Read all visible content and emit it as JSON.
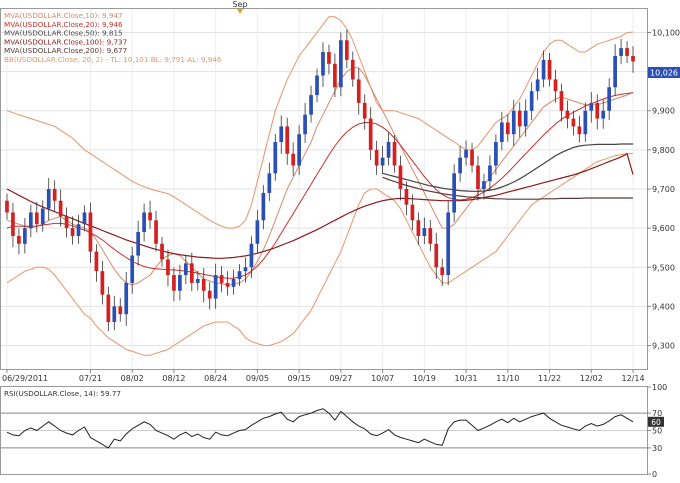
{
  "chart_data": [
    {
      "type": "candlestick",
      "panel": "price",
      "time_marker": "Sep",
      "last_price": "10,026",
      "ylim": [
        9240,
        10160
      ],
      "y_ticks": [
        9300,
        9400,
        9500,
        9600,
        9700,
        9800,
        9900,
        10000,
        10100
      ],
      "y_tick_labels": [
        "9,300",
        "9,400",
        "9,500",
        "9,600",
        "9,700",
        "9,800",
        "9,900",
        "10,000",
        "10,100"
      ],
      "x_tick_labels": [
        "06/29/2011",
        "07/21",
        "08/02",
        "08/12",
        "08/24",
        "09/05",
        "09/15",
        "09/27",
        "10/07",
        "10/19",
        "10/31",
        "11/10",
        "11/22",
        "12/02",
        "12/14"
      ],
      "x_tick_index": [
        0,
        14,
        21,
        28,
        35,
        42,
        49,
        56,
        63,
        70,
        77,
        84,
        91,
        98,
        105
      ],
      "legend": [
        {
          "text": "MVA(USDOLLAR.Close,10): 9,947",
          "color": "#d88a6a"
        },
        {
          "text": "MVA(USDOLLAR.Close,20): 9,946",
          "color": "#c83030"
        },
        {
          "text": "MVA(USDOLLAR.Close,50): 9,815",
          "color": "#444444"
        },
        {
          "text": "MVA(USDOLLAR.Close,100): 9,737",
          "color": "#8b1a1a"
        },
        {
          "text": "MVA(USDOLLAR.Close,200): 9,677",
          "color": "#5a3a3a"
        },
        {
          "text": "BB(USDOLLAR.Close, 20, 2) - TL: 10,101  BL: 9,791  AL: 9,946",
          "color": "#e8946a"
        }
      ],
      "series_colors": {
        "up": "#2a4fb5",
        "down": "#d42020"
      },
      "closes": [
        9640,
        9580,
        9560,
        9600,
        9640,
        9610,
        9650,
        9700,
        9670,
        9630,
        9600,
        9580,
        9610,
        9640,
        9540,
        9490,
        9430,
        9360,
        9400,
        9380,
        9460,
        9530,
        9590,
        9640,
        9620,
        9560,
        9520,
        9480,
        9440,
        9480,
        9510,
        9460,
        9470,
        9440,
        9420,
        9480,
        9460,
        9450,
        9470,
        9490,
        9500,
        9560,
        9620,
        9690,
        9740,
        9820,
        9860,
        9790,
        9760,
        9840,
        9890,
        9940,
        9990,
        10050,
        10020,
        9960,
        10080,
        10030,
        9980,
        9920,
        9880,
        9800,
        9760,
        9780,
        9820,
        9760,
        9700,
        9660,
        9620,
        9580,
        9600,
        9560,
        9500,
        9480,
        9640,
        9740,
        9780,
        9800,
        9760,
        9700,
        9720,
        9760,
        9820,
        9870,
        9840,
        9900,
        9860,
        9900,
        9950,
        9980,
        10030,
        9980,
        9950,
        9900,
        9880,
        9860,
        9840,
        9900,
        9920,
        9880,
        9900,
        9960,
        10040,
        10060,
        10040,
        10026
      ],
      "ma10": [
        9620,
        9615,
        9610,
        9605,
        9600,
        9605,
        9610,
        9620,
        9625,
        9630,
        9620,
        9610,
        9605,
        9600,
        9590,
        9570,
        9545,
        9520,
        9495,
        9475,
        9460,
        9455,
        9460,
        9470,
        9480,
        9500,
        9520,
        9530,
        9535,
        9530,
        9515,
        9500,
        9485,
        9470,
        9465,
        9460,
        9458,
        9455,
        9456,
        9460,
        9470,
        9490,
        9515,
        9545,
        9580,
        9620,
        9660,
        9700,
        9730,
        9760,
        9790,
        9820,
        9860,
        9890,
        9920,
        9950,
        9980,
        10000,
        10010,
        10010,
        9990,
        9960,
        9930,
        9900,
        9870,
        9840,
        9810,
        9780,
        9750,
        9720,
        9690,
        9660,
        9630,
        9600,
        9600,
        9610,
        9630,
        9650,
        9670,
        9690,
        9710,
        9730,
        9750,
        9770,
        9790,
        9810,
        9830,
        9850,
        9870,
        9890,
        9910,
        9920,
        9930,
        9935,
        9930,
        9925,
        9920,
        9915,
        9915,
        9915,
        9920,
        9925,
        9930,
        9935,
        9940,
        9947
      ],
      "ma20": [
        9600,
        9605,
        9605,
        9605,
        9605,
        9605,
        9608,
        9610,
        9612,
        9612,
        9610,
        9606,
        9600,
        9595,
        9588,
        9580,
        9570,
        9558,
        9546,
        9535,
        9525,
        9515,
        9508,
        9502,
        9498,
        9496,
        9495,
        9494,
        9493,
        9492,
        9490,
        9488,
        9485,
        9482,
        9479,
        9476,
        9473,
        9472,
        9472,
        9475,
        9480,
        9490,
        9503,
        9520,
        9540,
        9562,
        9587,
        9612,
        9637,
        9662,
        9687,
        9712,
        9737,
        9762,
        9787,
        9810,
        9830,
        9846,
        9858,
        9866,
        9870,
        9870,
        9866,
        9858,
        9846,
        9830,
        9812,
        9792,
        9772,
        9752,
        9732,
        9714,
        9698,
        9686,
        9678,
        9674,
        9672,
        9674,
        9678,
        9684,
        9692,
        9702,
        9714,
        9727,
        9742,
        9758,
        9774,
        9790,
        9806,
        9822,
        9838,
        9852,
        9866,
        9878,
        9888,
        9896,
        9904,
        9912,
        9918,
        9924,
        9930,
        9935,
        9939,
        9942,
        9944,
        9946
      ],
      "ma50": [
        null,
        null,
        null,
        null,
        null,
        null,
        null,
        null,
        null,
        null,
        null,
        null,
        null,
        null,
        null,
        null,
        null,
        null,
        null,
        null,
        null,
        null,
        null,
        null,
        null,
        null,
        null,
        null,
        null,
        null,
        null,
        null,
        null,
        null,
        null,
        null,
        null,
        null,
        null,
        null,
        null,
        null,
        null,
        null,
        null,
        null,
        null,
        null,
        null,
        null,
        null,
        null,
        null,
        null,
        null,
        null,
        null,
        null,
        null,
        null,
        null,
        null,
        null,
        9740,
        9736,
        9732,
        9728,
        9724,
        9720,
        9716,
        9712,
        9708,
        9705,
        9702,
        9700,
        9698,
        9696,
        9695,
        9694,
        9694,
        9695,
        9697,
        9700,
        9705,
        9711,
        9718,
        9726,
        9735,
        9745,
        9755,
        9765,
        9775,
        9785,
        9793,
        9800,
        9806,
        9810,
        9812,
        9813,
        9814,
        9814,
        9814,
        9814,
        9815,
        9815,
        9815
      ],
      "ma100": [
        9700,
        9692,
        9684,
        9676,
        9668,
        9661,
        9654,
        9648,
        9642,
        9636,
        9630,
        9624,
        9618,
        9612,
        9606,
        9600,
        9594,
        9588,
        9582,
        9576,
        9570,
        9565,
        9560,
        9555,
        9550,
        9546,
        9542,
        9538,
        9535,
        9532,
        9530,
        9528,
        9526,
        9525,
        9524,
        9523,
        9523,
        9524,
        9525,
        9527,
        9529,
        9532,
        9536,
        9540,
        9545,
        9550,
        9556,
        9562,
        9568,
        9575,
        9582,
        9589,
        9596,
        9604,
        9612,
        9620,
        9628,
        9636,
        9643,
        9650,
        9656,
        9661,
        9666,
        9670,
        9673,
        9675,
        9676,
        9676,
        9675,
        9674,
        9673,
        9672,
        9671,
        9670,
        9670,
        9670,
        9670,
        9671,
        9673,
        9675,
        9678,
        9681,
        9684,
        9688,
        9692,
        9696,
        9700,
        9704,
        9708,
        9712,
        9716,
        9720,
        9724,
        9728,
        9732,
        9736,
        9741,
        9746,
        9752,
        9758,
        9764,
        9770,
        9776,
        9782,
        9790,
        9737
      ],
      "ma200": [
        null,
        null,
        null,
        null,
        null,
        null,
        null,
        null,
        null,
        null,
        null,
        null,
        null,
        null,
        null,
        null,
        null,
        null,
        null,
        null,
        null,
        null,
        null,
        null,
        null,
        null,
        null,
        null,
        null,
        null,
        null,
        null,
        null,
        null,
        null,
        null,
        null,
        null,
        null,
        null,
        null,
        null,
        null,
        null,
        null,
        null,
        null,
        null,
        null,
        null,
        null,
        null,
        null,
        null,
        null,
        null,
        null,
        null,
        null,
        null,
        null,
        null,
        null,
        9730,
        9724,
        9719,
        9714,
        9709,
        9705,
        9701,
        9697,
        9694,
        9691,
        9688,
        9686,
        9684,
        9682,
        9680,
        9679,
        9678,
        9677,
        9676,
        9675,
        9675,
        9674,
        9674,
        9674,
        9674,
        9674,
        9674,
        9675,
        9675,
        9675,
        9676,
        9676,
        9676,
        9676,
        9677,
        9677,
        9677,
        9677,
        9677,
        9677,
        9677,
        9677,
        9677
      ],
      "bb_upper": [
        9900,
        9895,
        9890,
        9885,
        9880,
        9875,
        9870,
        9865,
        9860,
        9850,
        9840,
        9830,
        9815,
        9800,
        9790,
        9780,
        9770,
        9760,
        9750,
        9740,
        9730,
        9720,
        9712,
        9706,
        9700,
        9696,
        9692,
        9688,
        9680,
        9670,
        9660,
        9650,
        9640,
        9630,
        9620,
        9612,
        9605,
        9600,
        9600,
        9605,
        9620,
        9660,
        9720,
        9780,
        9840,
        9900,
        9940,
        9980,
        10010,
        10040,
        10060,
        10080,
        10100,
        10120,
        10140,
        10140,
        10130,
        10110,
        10080,
        10040,
        10000,
        9960,
        9920,
        9900,
        9900,
        9900,
        9895,
        9890,
        9885,
        9880,
        9870,
        9860,
        9850,
        9840,
        9830,
        9820,
        9810,
        9800,
        9800,
        9810,
        9830,
        9850,
        9870,
        9880,
        9890,
        9910,
        9930,
        9960,
        9990,
        10020,
        10050,
        10070,
        10080,
        10080,
        10070,
        10060,
        10050,
        10050,
        10060,
        10070,
        10075,
        10080,
        10085,
        10090,
        10100,
        10101
      ],
      "bb_lower": [
        9460,
        9470,
        9480,
        9490,
        9495,
        9500,
        9500,
        9495,
        9480,
        9460,
        9440,
        9420,
        9400,
        9380,
        9370,
        9350,
        9335,
        9320,
        9310,
        9300,
        9290,
        9285,
        9280,
        9275,
        9275,
        9280,
        9285,
        9290,
        9300,
        9310,
        9320,
        9330,
        9340,
        9350,
        9355,
        9360,
        9360,
        9360,
        9350,
        9340,
        9320,
        9310,
        9305,
        9300,
        9300,
        9305,
        9310,
        9320,
        9330,
        9350,
        9370,
        9390,
        9420,
        9450,
        9480,
        9510,
        9540,
        9580,
        9620,
        9660,
        9690,
        9700,
        9700,
        9690,
        9680,
        9670,
        9650,
        9620,
        9590,
        9560,
        9530,
        9500,
        9480,
        9460,
        9460,
        9470,
        9480,
        9490,
        9500,
        9510,
        9520,
        9530,
        9540,
        9560,
        9580,
        9600,
        9620,
        9640,
        9660,
        9670,
        9680,
        9690,
        9700,
        9710,
        9720,
        9730,
        9740,
        9750,
        9760,
        9770,
        9775,
        9780,
        9785,
        9788,
        9790,
        9791
      ]
    },
    {
      "type": "line",
      "panel": "rsi",
      "legend": [
        {
          "text": "RSI(USDOLLAR.Close, 14): 59.77",
          "color": "#333333"
        }
      ],
      "ylim": [
        0,
        100
      ],
      "y_ticks": [
        0,
        30,
        50,
        70,
        100
      ],
      "y_tick_labels": [
        "0",
        "30",
        "50",
        "70",
        "100"
      ],
      "last_value": "60",
      "guides": [
        30,
        50,
        70
      ],
      "values": [
        48,
        45,
        44,
        50,
        53,
        50,
        55,
        60,
        55,
        50,
        47,
        45,
        50,
        54,
        42,
        38,
        34,
        30,
        40,
        38,
        46,
        52,
        56,
        60,
        57,
        50,
        47,
        44,
        40,
        45,
        48,
        43,
        46,
        42,
        40,
        48,
        45,
        44,
        47,
        50,
        51,
        56,
        60,
        64,
        66,
        69,
        71,
        63,
        60,
        66,
        68,
        70,
        73,
        75,
        70,
        62,
        72,
        66,
        60,
        55,
        52,
        46,
        44,
        47,
        51,
        45,
        42,
        40,
        38,
        36,
        40,
        37,
        34,
        33,
        52,
        60,
        62,
        62,
        56,
        50,
        53,
        56,
        60,
        63,
        59,
        64,
        60,
        63,
        66,
        68,
        70,
        64,
        60,
        56,
        54,
        52,
        50,
        55,
        58,
        55,
        57,
        61,
        66,
        68,
        64,
        60
      ]
    }
  ]
}
